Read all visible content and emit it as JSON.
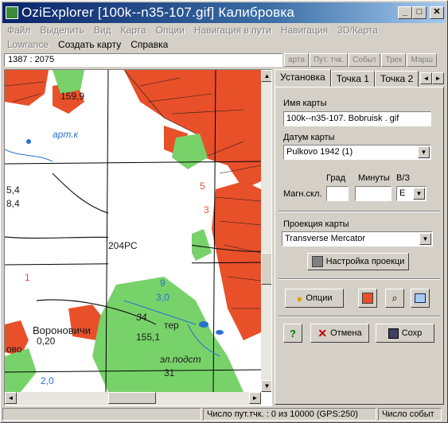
{
  "window": {
    "title": "OziExplorer [100k--n35-107.gif] Калибровка",
    "min": "_",
    "max": "□",
    "close": "✕"
  },
  "menu_disabled": [
    "Файл",
    "Выделить",
    "Вид",
    "Карта",
    "Опции",
    "Навигация в пути",
    "Навигация",
    "3D/Карта"
  ],
  "menu_row2": {
    "lowrance": "Lowrance",
    "create_map": "Создать карту",
    "help": "Справка"
  },
  "coords": "1387 : 2075",
  "toolbar_tabs": [
    "арта",
    "Пут. тчк.",
    "Событ",
    "Трек",
    "Марш"
  ],
  "map_labels": {
    "l1": "159,9",
    "l2": "арт.к",
    "l3": "5,4",
    "l4": "8,4",
    "l5": "204РС",
    "l6": "9",
    "l7": "3,0",
    "l8": "34",
    "l9": "Вороновичи",
    "l10": "0,20",
    "l11": "155,1",
    "l12": "тер",
    "l13": "эл.подст",
    "l14": "ово",
    "l15": "2,0",
    "l16": "31",
    "l17": "5",
    "l18": "3",
    "l19": "1"
  },
  "tabs": {
    "setup": "Установка",
    "point1": "Точка 1",
    "point2": "Точка 2",
    "left": "◄",
    "right": "►"
  },
  "form": {
    "map_name_label": "Имя карты",
    "map_name": "100k--n35-107. Bobruisk . gif",
    "datum_label": "Датум карты",
    "datum": "Pulkovo 1942 (1)",
    "deg": "Град",
    "min": "Минуты",
    "ew": "В/З",
    "magvar_label": "Магн.скл.",
    "ew_value": "E",
    "projection_label": "Проекция карты",
    "projection": "Transverse Mercator",
    "proj_setup": "Настройка проекци",
    "options": "Опции",
    "help": "?",
    "cancel": "Отмена",
    "save": "Сохр"
  },
  "status": {
    "points": "Число пут.тчк. : 0 из 10000  (GPS:250)",
    "events": "Число событ"
  },
  "colors": {
    "title_start": "#0a246a",
    "title_end": "#a6caf0",
    "urban": "#e8502a",
    "forest": "#78d26a",
    "water": "#2a6fd0"
  }
}
